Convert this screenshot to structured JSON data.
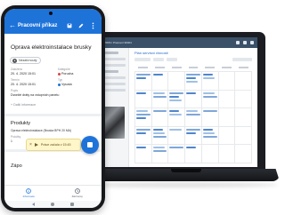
{
  "colors": {
    "primary": "#1e73d9",
    "priority_high": "#d64545",
    "type": "#1e73d9",
    "toast_bg": "#fff6c9"
  },
  "desktop": {
    "breadcrumb": "• T 780S / Pracovní 90001",
    "plan_title": "Plán servisní činnosti"
  },
  "phone": {
    "app_bar": {
      "title": "Pracovní příkaz",
      "back_icon": "arrow-left-icon",
      "actions": [
        "save-icon",
        "edit-icon",
        "more-icon"
      ]
    },
    "order": {
      "title": "Oprava elektroinstalace brusky",
      "status_label": "Nezahrnoutý",
      "fields": [
        {
          "label": "Založeno",
          "value": "20. 4. 2020 15:01"
        },
        {
          "label": "Kategorie",
          "value": "Porucha"
        },
        {
          "label": "Termín",
          "value": "20. 4. 2020 15:01"
        },
        {
          "label": "Typ",
          "value": "Vysoká"
        },
        {
          "label": "Popis",
          "value": "Dvonité dráty na vstupních panelu"
        }
      ],
      "add_attachment": "+ Další informace"
    },
    "section_products": {
      "title": "Produkty",
      "line1": "Oprava elektroinstalace (Bruska BPH 20 MA)",
      "note_label": "Položky",
      "note_value": "1"
    },
    "section_notes": {
      "title": "Zápo"
    },
    "timer": {
      "label": "Práce začala v 15:45"
    },
    "bottom_nav": [
      {
        "label": "Informace",
        "icon": "info-icon"
      },
      {
        "label": "Záznamy",
        "icon": "records-icon"
      }
    ]
  }
}
